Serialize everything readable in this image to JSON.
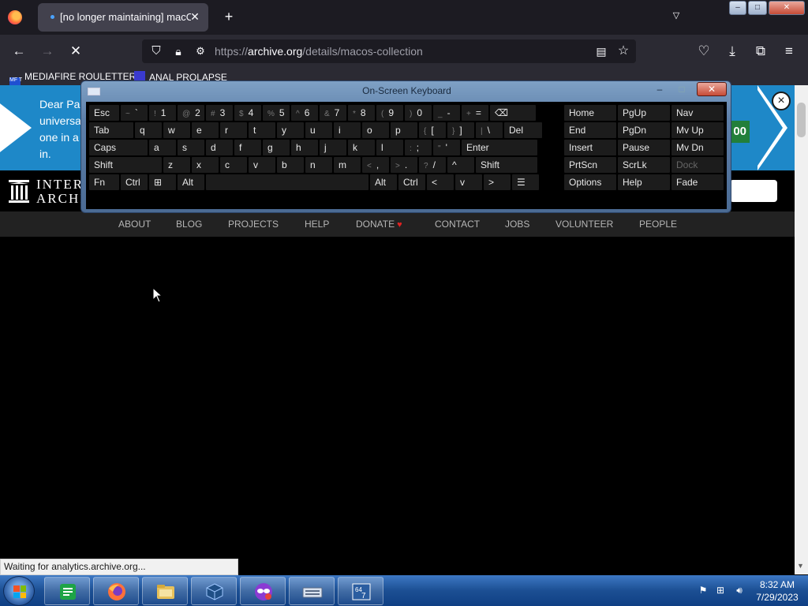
{
  "browser": {
    "tab_title": "[no longer maintaining] macOS",
    "new_tab_glyph": "+",
    "url_prefix": "https://",
    "url_domain": "archive.org",
    "url_path": "/details/macos-collection",
    "bookmarks": [
      {
        "label": "MEDIAFIRE ROULETTER",
        "icon_text": "MF T"
      },
      {
        "label": "ANAL PROLAPSE",
        "icon_text": ""
      }
    ],
    "icons": [
      "back-icon",
      "forward-icon",
      "loading-icon",
      "shield-icon",
      "lock-icon",
      "permissions-icon",
      "reader-icon",
      "bookmark-star-icon",
      "pocket-icon",
      "downloads-icon",
      "extensions-icon",
      "menu-icon"
    ]
  },
  "banner": {
    "text": "Dear Pa universa one in a in.",
    "amount": "00",
    "close_glyph": "×"
  },
  "site": {
    "logo_line1": "INTER",
    "logo_line2": "ARCHI",
    "nav": [
      "ABOUT",
      "BLOG",
      "PROJECTS",
      "HELP",
      "DONATE",
      "CONTACT",
      "JOBS",
      "VOLUNTEER",
      "PEOPLE"
    ]
  },
  "status_text": "Waiting for analytics.archive.org...",
  "osk": {
    "title": "On-Screen Keyboard",
    "rows": [
      [
        [
          "",
          "Esc"
        ],
        [
          "~",
          "`"
        ],
        [
          "!",
          "1"
        ],
        [
          "@",
          "2"
        ],
        [
          "#",
          "3"
        ],
        [
          "$",
          "4"
        ],
        [
          "%",
          "5"
        ],
        [
          "^",
          "6"
        ],
        [
          "&",
          "7"
        ],
        [
          "*",
          "8"
        ],
        [
          "(",
          "9"
        ],
        [
          ")",
          "0"
        ],
        [
          "_",
          "-"
        ],
        [
          "+",
          "="
        ],
        [
          "",
          "⌫"
        ]
      ],
      [
        [
          "",
          "Tab"
        ],
        [
          "",
          "q"
        ],
        [
          "",
          "w"
        ],
        [
          "",
          "e"
        ],
        [
          "",
          "r"
        ],
        [
          "",
          "t"
        ],
        [
          "",
          "y"
        ],
        [
          "",
          "u"
        ],
        [
          "",
          "i"
        ],
        [
          "",
          "o"
        ],
        [
          "",
          "p"
        ],
        [
          "{",
          "["
        ],
        [
          "}",
          "]"
        ],
        [
          "|",
          "\\"
        ],
        [
          "",
          "Del"
        ]
      ],
      [
        [
          "",
          "Caps"
        ],
        [
          "",
          "a"
        ],
        [
          "",
          "s"
        ],
        [
          "",
          "d"
        ],
        [
          "",
          "f"
        ],
        [
          "",
          "g"
        ],
        [
          "",
          "h"
        ],
        [
          "",
          "j"
        ],
        [
          "",
          "k"
        ],
        [
          "",
          "l"
        ],
        [
          ":",
          ";"
        ],
        [
          "\"",
          "'"
        ],
        [
          "",
          "Enter"
        ]
      ],
      [
        [
          "",
          "Shift"
        ],
        [
          "",
          "z"
        ],
        [
          "",
          "x"
        ],
        [
          "",
          "c"
        ],
        [
          "",
          "v"
        ],
        [
          "",
          "b"
        ],
        [
          "",
          "n"
        ],
        [
          "",
          "m"
        ],
        [
          "<",
          ","
        ],
        [
          ">",
          "."
        ],
        [
          "?",
          "/"
        ],
        [
          "",
          "^"
        ],
        [
          "",
          "Shift"
        ]
      ],
      [
        [
          "",
          "Fn"
        ],
        [
          "",
          "Ctrl"
        ],
        [
          "",
          "⊞"
        ],
        [
          "",
          "Alt"
        ],
        [
          "",
          ""
        ],
        [
          "",
          "Alt"
        ],
        [
          "",
          "Ctrl"
        ],
        [
          "",
          "<"
        ],
        [
          "",
          "v"
        ],
        [
          "",
          ">"
        ],
        [
          "",
          "☰"
        ]
      ]
    ],
    "side_keys": [
      [
        "Home",
        "PgUp",
        "Nav"
      ],
      [
        "End",
        "PgDn",
        "Mv Up"
      ],
      [
        "Insert",
        "Pause",
        "Mv Dn"
      ],
      [
        "PrtScn",
        "ScrLk",
        "Dock"
      ],
      [
        "Options",
        "Help",
        "Fade"
      ]
    ]
  },
  "taskbar": {
    "time": "8:32 AM",
    "date": "7/29/2023",
    "apps": [
      "sheets-app-icon",
      "firefox-app-icon",
      "explorer-app-icon",
      "virtualbox-app-icon",
      "privacy-app-icon",
      "keyboard-app-icon",
      "app-64-icon"
    ]
  },
  "colors": {
    "banner": "#1e88c8",
    "donate_heart": "#e02222",
    "browser_bg": "#2b2a33"
  }
}
